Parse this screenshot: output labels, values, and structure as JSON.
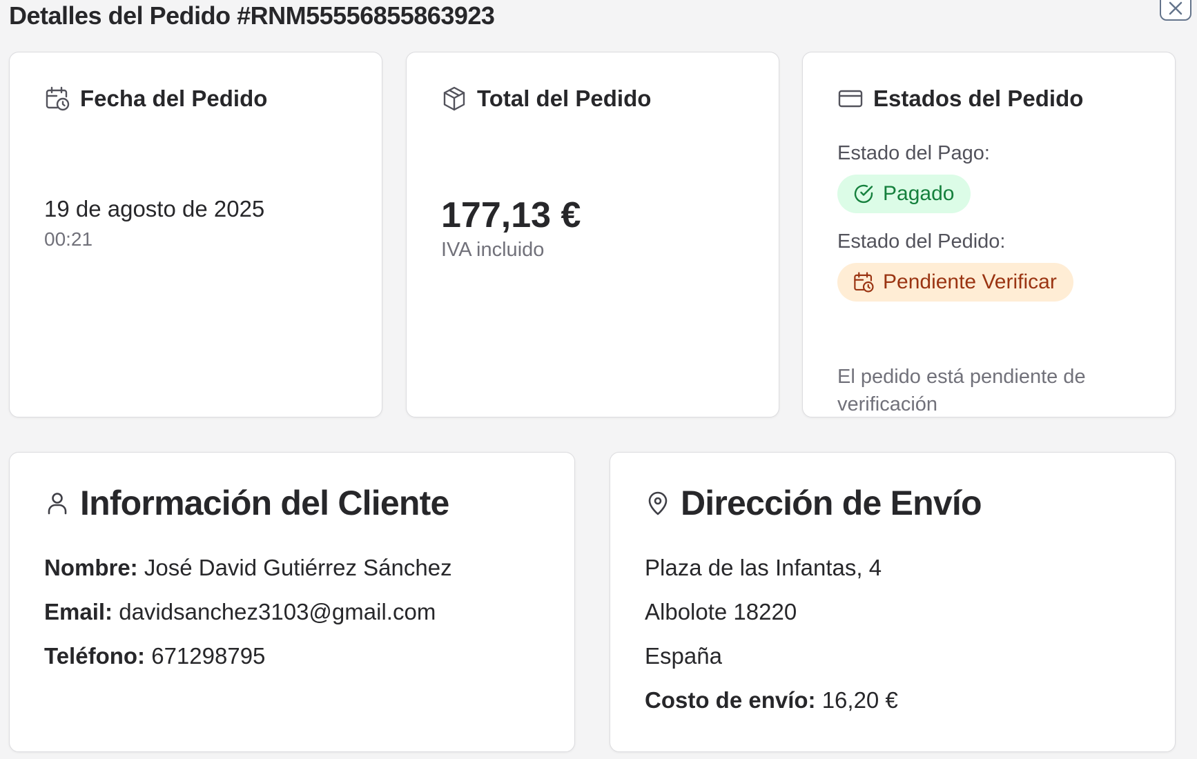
{
  "modal": {
    "title": "Detalles del Pedido #RNM55556855863923"
  },
  "date_card": {
    "title": "Fecha del Pedido",
    "date": "19 de agosto de 2025",
    "time": "00:21"
  },
  "total_card": {
    "title": "Total del Pedido",
    "amount": "177,13 €",
    "note": "IVA incluido"
  },
  "status_card": {
    "title": "Estados del Pedido",
    "payment_label": "Estado del Pago:",
    "payment_status": "Pagado",
    "order_label": "Estado del Pedido:",
    "order_status": "Pendiente Verificar",
    "description": "El pedido está pendiente de verificación"
  },
  "customer_card": {
    "title": "Información del Cliente",
    "name_label": "Nombre:",
    "name": "José David Gutiérrez Sánchez",
    "email_label": "Email:",
    "email": "davidsanchez3103@gmail.com",
    "phone_label": "Teléfono:",
    "phone": "671298795"
  },
  "shipping_card": {
    "title": "Dirección de Envío",
    "street": "Plaza de las Infantas, 4",
    "city": "Albolote 18220",
    "country": "España",
    "cost_label": "Costo de envío:",
    "cost": "16,20 €"
  },
  "icons": {
    "date": "calendar-clock-icon",
    "total": "package-icon",
    "status": "credit-card-icon",
    "paid": "check-circle-icon",
    "pending": "calendar-clock-icon",
    "customer": "user-icon",
    "shipping": "map-pin-icon",
    "close": "close-icon"
  },
  "colors": {
    "paid_bg": "#dcfce7",
    "paid_text": "#15803d",
    "pending_bg": "#ffedd5",
    "pending_text": "#9a3412"
  }
}
